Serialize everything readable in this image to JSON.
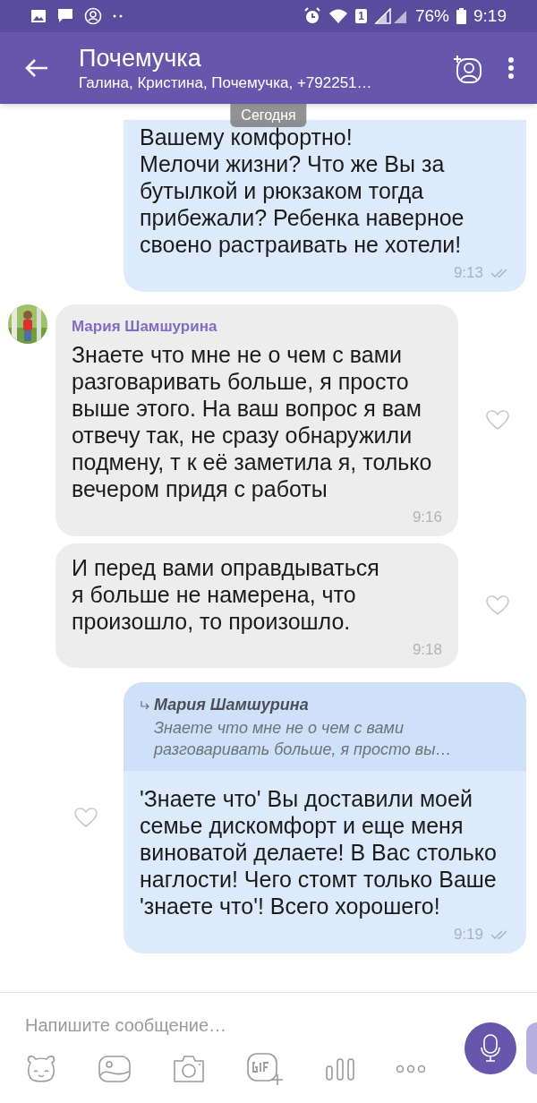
{
  "status_bar": {
    "battery": "76%",
    "sim": "1",
    "time": "9:19"
  },
  "header": {
    "title": "Почемучка",
    "subtitle": "Галина, Кристина, Почемучка, +792251…"
  },
  "date_chip": "Сегодня",
  "messages": [
    {
      "kind": "outgoing",
      "text": "Вашему комфортно!\nМелочи жизни? Что же Вы за бутылкой и рюкзаком тогда прибежали? Ребенка наверное своено растраивать не хотели!",
      "time": "9:13",
      "read": true
    },
    {
      "kind": "incoming",
      "sender": "Мария Шамшурина",
      "avatar": true,
      "text": "Знаете что мне не о чем с вами разговаривать больше, я просто выше этого. На ваш вопрос я вам отвечу так, не сразу обнаружили подмену, т к её заметила я, только вечером придя с работы",
      "time": "9:16",
      "liked": false
    },
    {
      "kind": "incoming",
      "avatar": false,
      "text": "И перед вами оправдываться\nя больше не намерена, что произошло, то произошло.",
      "time": "9:18",
      "liked": false
    },
    {
      "kind": "outgoing",
      "quote": {
        "sender": "Мария Шамшурина",
        "text": "Знаете что мне не о чем с вами разговаривать больше, я просто вы…"
      },
      "text": "'Знаете что' Вы доставили моей семье дискомфорт и еще меня виноватой делаете! В Вас столько наглости! Чего стомт только Ваше 'знаете что'! Всего хорошего!",
      "time": "9:19",
      "read": true,
      "liked": false
    }
  ],
  "composer": {
    "placeholder": "Напишите сообщение…"
  }
}
